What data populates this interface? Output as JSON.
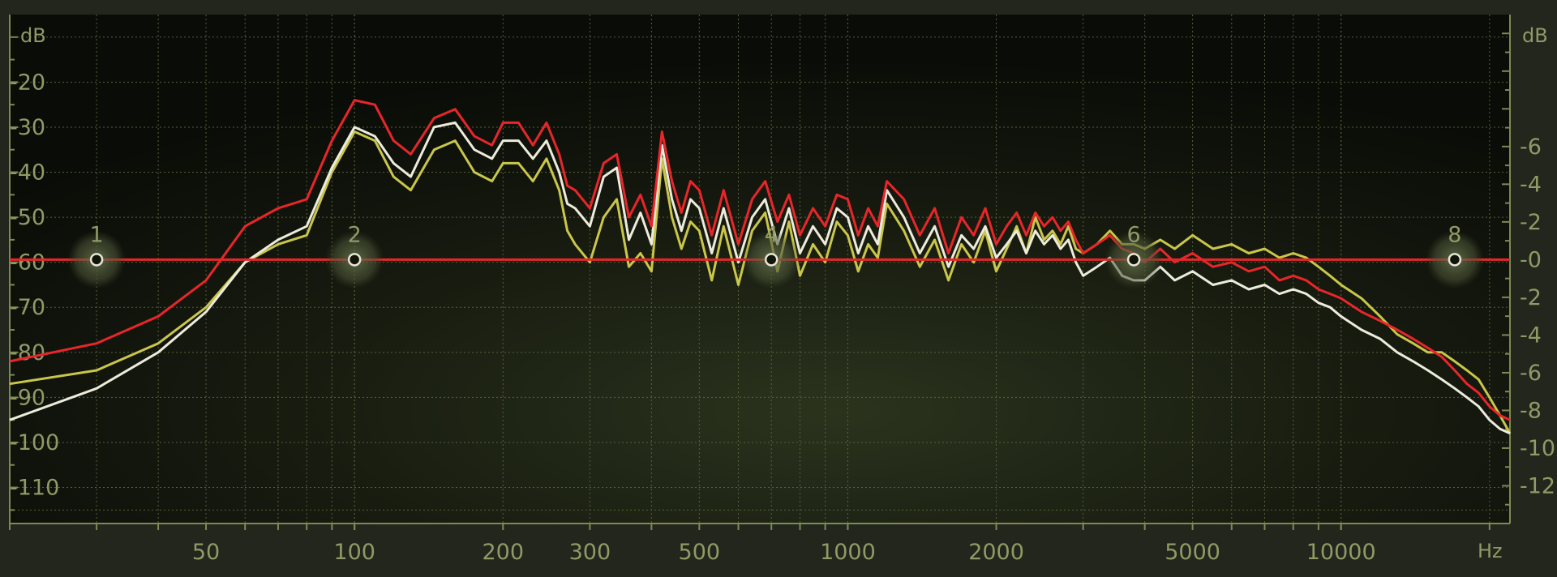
{
  "panel": {
    "left_unit": "dB",
    "right_unit": "dB",
    "x_unit": "Hz",
    "colors": {
      "background": "#0f120a",
      "grid": "#56603a",
      "axis_text": "#8f9a66",
      "eq_line": "#e8262a",
      "node_glow": "#5f6945"
    }
  },
  "chart_data": {
    "type": "line",
    "xlabel": "Hz",
    "ylabel": "dB",
    "y2label": "dB",
    "x_scale": "log",
    "xlim": [
      20,
      22000
    ],
    "ylim": [
      -118,
      -5
    ],
    "y2lim": [
      -14,
      13
    ],
    "grid": true,
    "x_ticks": [
      50,
      100,
      200,
      300,
      500,
      1000,
      2000,
      5000,
      10000
    ],
    "x_tick_labels": [
      "50",
      "100",
      "200",
      "300",
      "500",
      "1000",
      "2000",
      "5000",
      "10000"
    ],
    "y_ticks": [
      -20,
      -30,
      -40,
      -50,
      -60,
      -70,
      -80,
      -90,
      -100,
      -110
    ],
    "y_tick_labels": [
      "-20",
      "-30",
      "-40",
      "-50",
      "-60",
      "-70",
      "-80",
      "-90",
      "-100",
      "-110"
    ],
    "y2_ticks": [
      6,
      4,
      2,
      0,
      -2,
      -4,
      -6,
      -8,
      -10,
      -12
    ],
    "y2_tick_labels": [
      "-6",
      "-4",
      "-2",
      "-0",
      "-2",
      "-4",
      "-6",
      "-8",
      "-10",
      "-12"
    ],
    "series": [
      {
        "color": "#e8262a",
        "x": [
          20,
          30,
          40,
          50,
          60,
          70,
          80,
          90,
          100,
          110,
          120,
          130,
          145,
          160,
          175,
          190,
          200,
          215,
          230,
          245,
          260,
          270,
          280,
          300,
          320,
          340,
          360,
          380,
          400,
          420,
          440,
          460,
          480,
          500,
          530,
          560,
          600,
          640,
          680,
          720,
          760,
          800,
          850,
          900,
          950,
          1000,
          1050,
          1100,
          1150,
          1200,
          1300,
          1400,
          1500,
          1600,
          1700,
          1800,
          1900,
          2000,
          2100,
          2200,
          2300,
          2400,
          2500,
          2600,
          2700,
          2800,
          2900,
          3000,
          3200,
          3400,
          3600,
          3800,
          4000,
          4300,
          4600,
          5000,
          5500,
          6000,
          6500,
          7000,
          7500,
          8000,
          8500,
          9000,
          9500,
          10000,
          11000,
          12000,
          13000,
          14000,
          15000,
          16000,
          17000,
          18000,
          19000,
          20000,
          21000,
          22000
        ],
        "y": [
          -82,
          -78,
          -72,
          -64,
          -52,
          -48,
          -46,
          -33,
          -24,
          -25,
          -33,
          -36,
          -28,
          -26,
          -32,
          -34,
          -29,
          -29,
          -34,
          -29,
          -36,
          -43,
          -44,
          -48,
          -38,
          -36,
          -50,
          -45,
          -52,
          -31,
          -42,
          -49,
          -42,
          -44,
          -54,
          -44,
          -56,
          -46,
          -42,
          -51,
          -45,
          -54,
          -48,
          -52,
          -45,
          -46,
          -54,
          -48,
          -52,
          -42,
          -46,
          -54,
          -48,
          -58,
          -50,
          -54,
          -48,
          -56,
          -52,
          -49,
          -54,
          -49,
          -52,
          -50,
          -53,
          -51,
          -55,
          -58,
          -56,
          -54,
          -57,
          -58,
          -60,
          -57,
          -60,
          -58,
          -61,
          -60,
          -62,
          -61,
          -64,
          -63,
          -64,
          -66,
          -67,
          -68,
          -71,
          -73,
          -75,
          -77,
          -79,
          -81,
          -84,
          -87,
          -89,
          -92,
          -94,
          -95
        ]
      },
      {
        "color": "#ecebdc",
        "x": [
          20,
          30,
          40,
          50,
          60,
          70,
          80,
          90,
          100,
          110,
          120,
          130,
          145,
          160,
          175,
          190,
          200,
          215,
          230,
          245,
          260,
          270,
          280,
          300,
          320,
          340,
          360,
          380,
          400,
          420,
          440,
          460,
          480,
          500,
          530,
          560,
          600,
          640,
          680,
          720,
          760,
          800,
          850,
          900,
          950,
          1000,
          1050,
          1100,
          1150,
          1200,
          1300,
          1400,
          1500,
          1600,
          1700,
          1800,
          1900,
          2000,
          2100,
          2200,
          2300,
          2400,
          2500,
          2600,
          2700,
          2800,
          2900,
          3000,
          3200,
          3400,
          3600,
          3800,
          4000,
          4300,
          4600,
          5000,
          5500,
          6000,
          6500,
          7000,
          7500,
          8000,
          8500,
          9000,
          9500,
          10000,
          11000,
          12000,
          13000,
          14000,
          15000,
          16000,
          17000,
          18000,
          19000,
          20000,
          21000,
          22000
        ],
        "y": [
          -95,
          -88,
          -80,
          -71,
          -60,
          -55,
          -52,
          -39,
          -30,
          -32,
          -38,
          -41,
          -30,
          -29,
          -35,
          -37,
          -33,
          -33,
          -37,
          -33,
          -40,
          -47,
          -48,
          -52,
          -41,
          -39,
          -55,
          -49,
          -56,
          -34,
          -46,
          -53,
          -46,
          -48,
          -58,
          -48,
          -60,
          -50,
          -46,
          -56,
          -48,
          -58,
          -52,
          -56,
          -48,
          -50,
          -58,
          -52,
          -56,
          -44,
          -50,
          -58,
          -52,
          -61,
          -54,
          -57,
          -52,
          -59,
          -56,
          -53,
          -58,
          -53,
          -56,
          -54,
          -57,
          -55,
          -60,
          -63,
          -61,
          -59,
          -63,
          -64,
          -64,
          -61,
          -64,
          -62,
          -65,
          -64,
          -66,
          -65,
          -67,
          -66,
          -67,
          -69,
          -70,
          -72,
          -75,
          -77,
          -80,
          -82,
          -84,
          -86,
          -88,
          -90,
          -92,
          -95,
          -97,
          -98
        ]
      },
      {
        "color": "#c9c64a",
        "x": [
          20,
          30,
          40,
          50,
          60,
          70,
          80,
          90,
          100,
          110,
          120,
          130,
          145,
          160,
          175,
          190,
          200,
          215,
          230,
          245,
          260,
          270,
          280,
          300,
          320,
          340,
          360,
          380,
          400,
          420,
          440,
          460,
          480,
          500,
          530,
          560,
          600,
          640,
          680,
          720,
          760,
          800,
          850,
          900,
          950,
          1000,
          1050,
          1100,
          1150,
          1200,
          1300,
          1400,
          1500,
          1600,
          1700,
          1800,
          1900,
          2000,
          2100,
          2200,
          2300,
          2400,
          2500,
          2600,
          2700,
          2800,
          2900,
          3000,
          3200,
          3400,
          3600,
          3800,
          4000,
          4300,
          4600,
          5000,
          5500,
          6000,
          6500,
          7000,
          7500,
          8000,
          8500,
          9000,
          9500,
          10000,
          11000,
          12000,
          13000,
          14000,
          15000,
          16000,
          17000,
          18000,
          19000,
          20000,
          21000,
          22000
        ],
        "y": [
          -87,
          -84,
          -78,
          -70,
          -60,
          -56,
          -54,
          -40,
          -31,
          -33,
          -41,
          -44,
          -35,
          -33,
          -40,
          -42,
          -38,
          -38,
          -42,
          -37,
          -44,
          -53,
          -56,
          -60,
          -50,
          -46,
          -61,
          -58,
          -62,
          -37,
          -50,
          -57,
          -51,
          -53,
          -64,
          -52,
          -65,
          -53,
          -49,
          -62,
          -51,
          -63,
          -56,
          -60,
          -51,
          -54,
          -62,
          -56,
          -59,
          -47,
          -53,
          -61,
          -55,
          -64,
          -56,
          -60,
          -53,
          -62,
          -57,
          -52,
          -58,
          -50,
          -55,
          -53,
          -56,
          -52,
          -57,
          -58,
          -56,
          -53,
          -56,
          -56,
          -57,
          -55,
          -57,
          -54,
          -57,
          -56,
          -58,
          -57,
          -59,
          -58,
          -59,
          -61,
          -63,
          -65,
          -68,
          -72,
          -76,
          -78,
          -80,
          -80,
          -82,
          -84,
          -86,
          -90,
          -94,
          -98
        ]
      }
    ],
    "eq_nodes": [
      {
        "label": "1",
        "freq": 30
      },
      {
        "label": "2",
        "freq": 100
      },
      {
        "label": "4",
        "freq": 700
      },
      {
        "label": "6",
        "freq": 3800
      },
      {
        "label": "8",
        "freq": 17000
      }
    ],
    "eq_line_gain": 0
  }
}
